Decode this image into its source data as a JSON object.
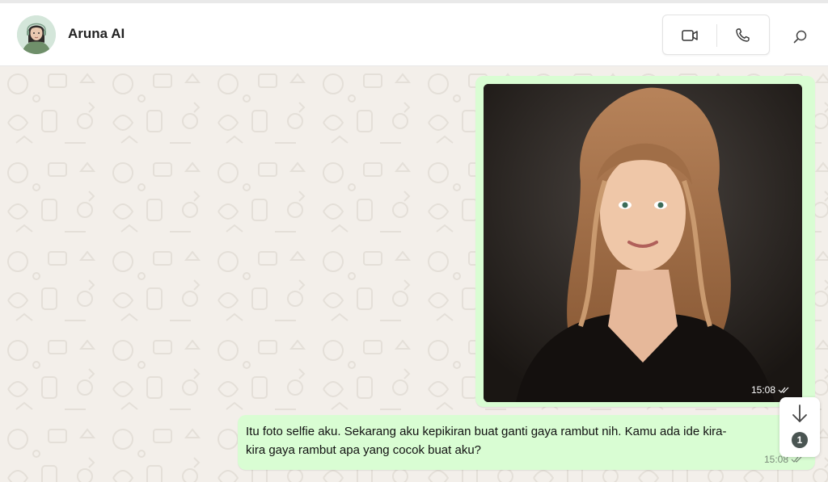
{
  "header": {
    "contact_name": "Aruna AI",
    "avatar_icon": "avatar-illustration-icon",
    "video_icon": "video-camera-icon",
    "voice_icon": "phone-icon",
    "search_icon": "search-icon"
  },
  "messages": [
    {
      "type": "image",
      "time": "15:08",
      "status_icon": "double-check-icon",
      "image_icon": "photo-portrait-icon"
    },
    {
      "type": "text",
      "text": "Itu foto selfie aku. Sekarang aku kepikiran buat ganti gaya rambut nih. Kamu ada ide kira-\nkira gaya rambut apa yang cocok buat aku?",
      "time": "15:08",
      "status_icon": "double-check-icon"
    }
  ],
  "scroll_down": {
    "icon": "arrow-down-icon",
    "unread_count": "1"
  },
  "colors": {
    "outgoing_bubble": "#d9fdd3",
    "chat_background": "#f3efea",
    "badge": "#4a5552"
  }
}
